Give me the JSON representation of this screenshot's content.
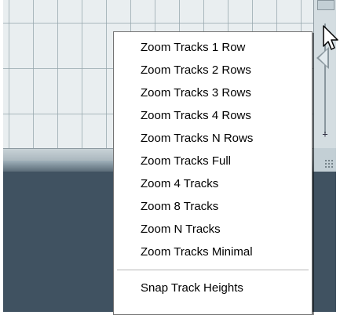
{
  "context_menu": {
    "items": [
      "Zoom Tracks 1 Row",
      "Zoom Tracks 2 Rows",
      "Zoom Tracks 3 Rows",
      "Zoom Tracks 4 Rows",
      "Zoom Tracks N Rows",
      "Zoom Tracks Full",
      "Zoom 4 Tracks",
      "Zoom 8 Tracks",
      "Zoom N Tracks",
      "Zoom Tracks Minimal"
    ],
    "footer_item": "Snap Track Heights"
  },
  "vertical_zoom": {
    "plus_label": "+"
  },
  "icons": {
    "cursor": "arrow-pointer-icon",
    "zoom_thumb": "triangle-left-icon",
    "size_grip": "resize-grip-icon"
  },
  "colors": {
    "background_panel": "#405261",
    "track_area": "#e9eef0",
    "menu_background": "#ffffff",
    "menu_text": "#000000"
  }
}
